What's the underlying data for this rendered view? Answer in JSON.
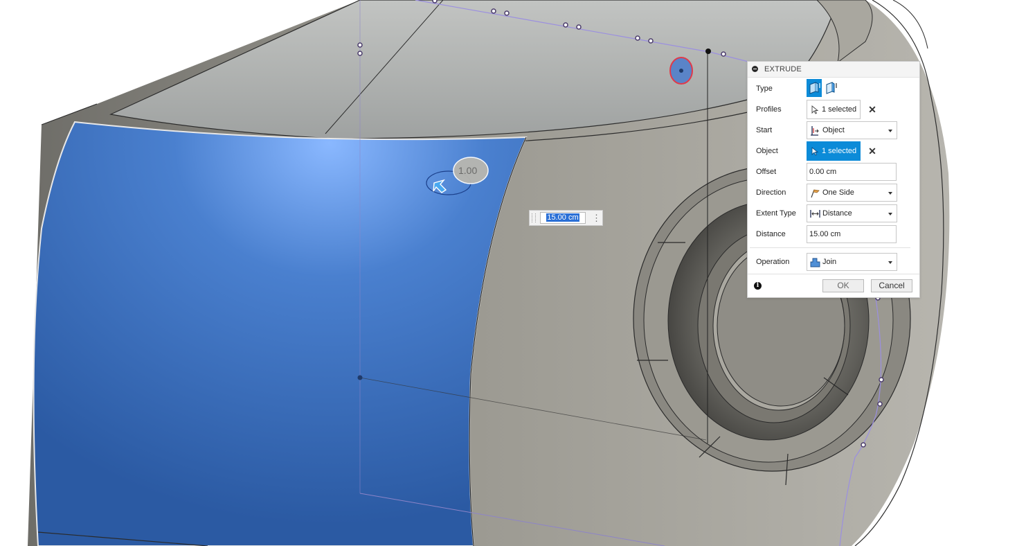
{
  "canvas": {
    "distance_input_value": "15.00 cm",
    "manipulator_label": "1.00"
  },
  "dialog": {
    "title": "EXTRUDE",
    "type": {
      "label": "Type",
      "options": [
        "solid-extrude-icon",
        "thin-extrude-icon"
      ],
      "selected": "solid-extrude-icon"
    },
    "profiles": {
      "label": "Profiles",
      "value": "1 selected"
    },
    "start": {
      "label": "Start",
      "value": "Object"
    },
    "object": {
      "label": "Object",
      "value": "1 selected"
    },
    "offset": {
      "label": "Offset",
      "value": "0.00 cm"
    },
    "direction": {
      "label": "Direction",
      "value": "One Side"
    },
    "extent_type": {
      "label": "Extent Type",
      "value": "Distance"
    },
    "distance": {
      "label": "Distance",
      "value": "15.00 cm"
    },
    "operation": {
      "label": "Operation",
      "value": "Join"
    },
    "ok_label": "OK",
    "cancel_label": "Cancel"
  },
  "colors": {
    "selected_face": "#3f74c2",
    "body": "#8f8d85",
    "accent": "#0c8bd8",
    "sketch_line": "#9b8fe0"
  }
}
